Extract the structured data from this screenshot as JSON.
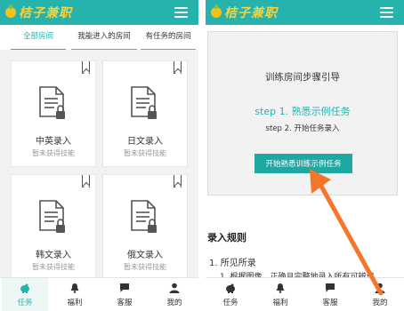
{
  "brand": {
    "name": "桔子兼职"
  },
  "tabs": [
    {
      "label": "全部房间",
      "active": true
    },
    {
      "label": "我能进入的房间",
      "active": false
    },
    {
      "label": "有任务的房间",
      "active": false
    }
  ],
  "rooms": [
    {
      "title": "中英录入",
      "status": "暂未获得技能"
    },
    {
      "title": "日文录入",
      "status": "暂未获得技能"
    },
    {
      "title": "韩文录入",
      "status": "暂未获得技能"
    },
    {
      "title": "俄文录入",
      "status": "暂未获得技能"
    }
  ],
  "bottom_nav": [
    {
      "label": "任务",
      "icon": "piggy-bank-icon",
      "active": true
    },
    {
      "label": "福利",
      "icon": "bell-icon",
      "active": false
    },
    {
      "label": "客服",
      "icon": "chat-icon",
      "active": false
    },
    {
      "label": "我的",
      "icon": "user-icon",
      "active": false
    }
  ],
  "guide": {
    "title": "训练房间步骤引导",
    "step1": "step 1. 熟悉示例任务",
    "step2": "step 2. 开始任务录入",
    "button": "开始熟悉训练示例任务"
  },
  "rules": {
    "title": "录入规则",
    "item1": "1. 所见所录",
    "item1_sub": "1. 根据图像，正确且完整地录入所有可辨识"
  },
  "colors": {
    "accent": "#26b3ad",
    "logo": "#f7d23a",
    "arrow": "#f5762a"
  }
}
